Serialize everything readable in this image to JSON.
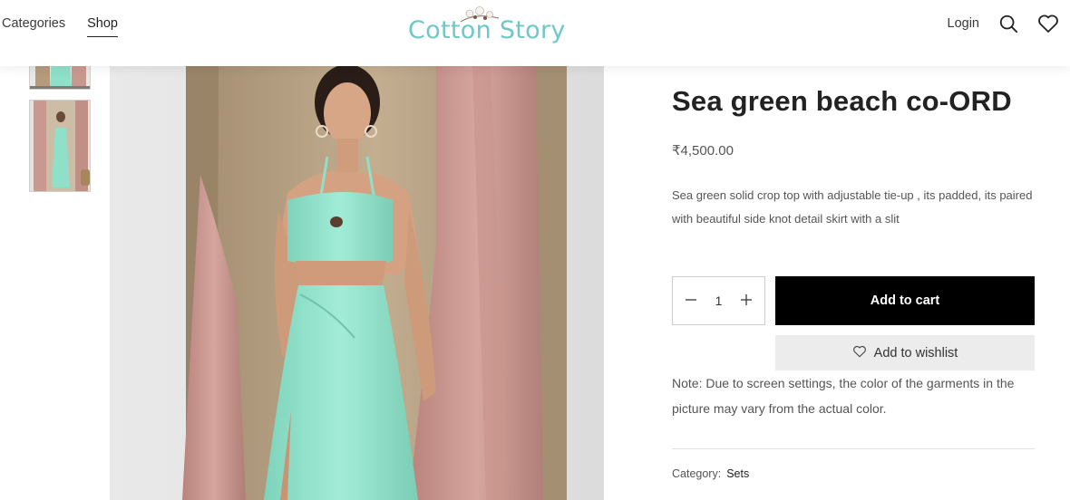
{
  "header": {
    "nav": [
      {
        "label": "Categories"
      },
      {
        "label": "Shop"
      }
    ],
    "logo_text": "Cotton Story",
    "login_label": "Login",
    "icons": [
      "search-icon",
      "heart-icon"
    ],
    "brand_color": "#6ec7c9"
  },
  "product": {
    "title": "Sea green beach co-ORD",
    "price": "₹4,500.00",
    "description": "Sea green solid crop top with adjustable tie-up , its padded, its paired with beautiful side knot detail skirt with a slit",
    "quantity": "1",
    "add_to_cart_label": "Add to cart",
    "wishlist_label": "Add to wishlist",
    "note": "Note: Due to screen settings, the color of the garments in the picture may vary from the actual color.",
    "category_label": "Category:",
    "category_value": "Sets"
  },
  "colors": {
    "dress": "#8fe0c8",
    "curtain_pink": "#c99690",
    "curtain_beige": "#b7a283",
    "button_black": "#000000"
  }
}
